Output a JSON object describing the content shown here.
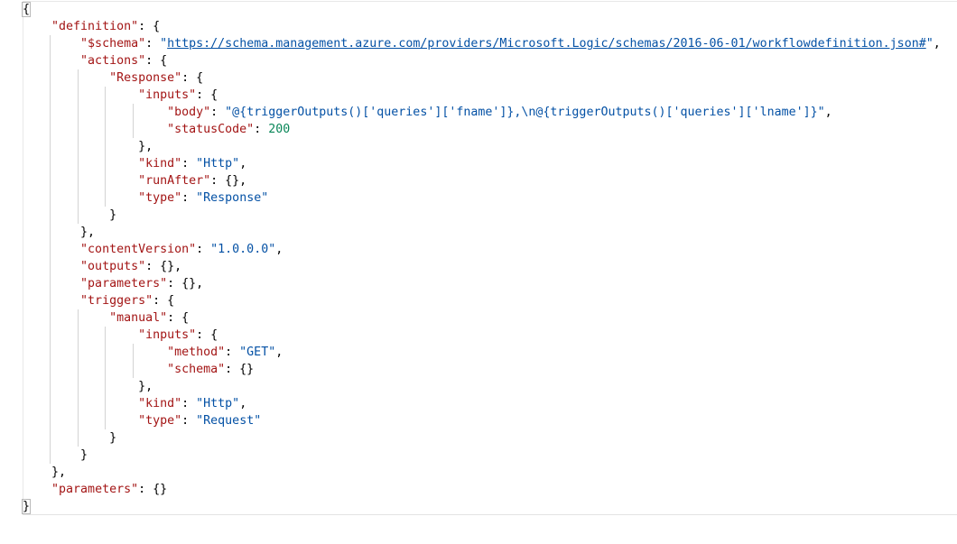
{
  "editor": {
    "lines": [
      [
        {
          "t": "p",
          "v": "{"
        }
      ],
      [
        {
          "t": "p",
          "v": "    "
        },
        {
          "t": "k",
          "v": "\"definition\""
        },
        {
          "t": "p",
          "v": ": {"
        }
      ],
      [
        {
          "t": "p",
          "v": "        "
        },
        {
          "t": "k",
          "v": "\"$schema\""
        },
        {
          "t": "p",
          "v": ": "
        },
        {
          "t": "s",
          "v": "\""
        },
        {
          "t": "u",
          "v": "https://schema.management.azure.com/providers/Microsoft.Logic/schemas/2016-06-01/workflowdefinition.json#"
        },
        {
          "t": "s",
          "v": "\""
        },
        {
          "t": "p",
          "v": ","
        }
      ],
      [
        {
          "t": "p",
          "v": "        "
        },
        {
          "t": "k",
          "v": "\"actions\""
        },
        {
          "t": "p",
          "v": ": {"
        }
      ],
      [
        {
          "t": "p",
          "v": "            "
        },
        {
          "t": "k",
          "v": "\"Response\""
        },
        {
          "t": "p",
          "v": ": {"
        }
      ],
      [
        {
          "t": "p",
          "v": "                "
        },
        {
          "t": "k",
          "v": "\"inputs\""
        },
        {
          "t": "p",
          "v": ": {"
        }
      ],
      [
        {
          "t": "p",
          "v": "                    "
        },
        {
          "t": "k",
          "v": "\"body\""
        },
        {
          "t": "p",
          "v": ": "
        },
        {
          "t": "s",
          "v": "\"@{triggerOutputs()['queries']['fname']},\\n@{triggerOutputs()['queries']['lname']}\""
        },
        {
          "t": "p",
          "v": ","
        }
      ],
      [
        {
          "t": "p",
          "v": "                    "
        },
        {
          "t": "k",
          "v": "\"statusCode\""
        },
        {
          "t": "p",
          "v": ": "
        },
        {
          "t": "n",
          "v": "200"
        }
      ],
      [
        {
          "t": "p",
          "v": "                },"
        }
      ],
      [
        {
          "t": "p",
          "v": "                "
        },
        {
          "t": "k",
          "v": "\"kind\""
        },
        {
          "t": "p",
          "v": ": "
        },
        {
          "t": "s",
          "v": "\"Http\""
        },
        {
          "t": "p",
          "v": ","
        }
      ],
      [
        {
          "t": "p",
          "v": "                "
        },
        {
          "t": "k",
          "v": "\"runAfter\""
        },
        {
          "t": "p",
          "v": ": {},"
        }
      ],
      [
        {
          "t": "p",
          "v": "                "
        },
        {
          "t": "k",
          "v": "\"type\""
        },
        {
          "t": "p",
          "v": ": "
        },
        {
          "t": "s",
          "v": "\"Response\""
        }
      ],
      [
        {
          "t": "p",
          "v": "            }"
        }
      ],
      [
        {
          "t": "p",
          "v": "        },"
        }
      ],
      [
        {
          "t": "p",
          "v": "        "
        },
        {
          "t": "k",
          "v": "\"contentVersion\""
        },
        {
          "t": "p",
          "v": ": "
        },
        {
          "t": "s",
          "v": "\"1.0.0.0\""
        },
        {
          "t": "p",
          "v": ","
        }
      ],
      [
        {
          "t": "p",
          "v": "        "
        },
        {
          "t": "k",
          "v": "\"outputs\""
        },
        {
          "t": "p",
          "v": ": {},"
        }
      ],
      [
        {
          "t": "p",
          "v": "        "
        },
        {
          "t": "k",
          "v": "\"parameters\""
        },
        {
          "t": "p",
          "v": ": {},"
        }
      ],
      [
        {
          "t": "p",
          "v": "        "
        },
        {
          "t": "k",
          "v": "\"triggers\""
        },
        {
          "t": "p",
          "v": ": {"
        }
      ],
      [
        {
          "t": "p",
          "v": "            "
        },
        {
          "t": "k",
          "v": "\"manual\""
        },
        {
          "t": "p",
          "v": ": {"
        }
      ],
      [
        {
          "t": "p",
          "v": "                "
        },
        {
          "t": "k",
          "v": "\"inputs\""
        },
        {
          "t": "p",
          "v": ": {"
        }
      ],
      [
        {
          "t": "p",
          "v": "                    "
        },
        {
          "t": "k",
          "v": "\"method\""
        },
        {
          "t": "p",
          "v": ": "
        },
        {
          "t": "s",
          "v": "\"GET\""
        },
        {
          "t": "p",
          "v": ","
        }
      ],
      [
        {
          "t": "p",
          "v": "                    "
        },
        {
          "t": "k",
          "v": "\"schema\""
        },
        {
          "t": "p",
          "v": ": {}"
        }
      ],
      [
        {
          "t": "p",
          "v": "                },"
        }
      ],
      [
        {
          "t": "p",
          "v": "                "
        },
        {
          "t": "k",
          "v": "\"kind\""
        },
        {
          "t": "p",
          "v": ": "
        },
        {
          "t": "s",
          "v": "\"Http\""
        },
        {
          "t": "p",
          "v": ","
        }
      ],
      [
        {
          "t": "p",
          "v": "                "
        },
        {
          "t": "k",
          "v": "\"type\""
        },
        {
          "t": "p",
          "v": ": "
        },
        {
          "t": "s",
          "v": "\"Request\""
        }
      ],
      [
        {
          "t": "p",
          "v": "            }"
        }
      ],
      [
        {
          "t": "p",
          "v": "        }"
        }
      ],
      [
        {
          "t": "p",
          "v": "    },"
        }
      ],
      [
        {
          "t": "p",
          "v": "    "
        },
        {
          "t": "k",
          "v": "\"parameters\""
        },
        {
          "t": "p",
          "v": ": {}"
        }
      ],
      [
        {
          "t": "p",
          "v": "}"
        }
      ]
    ]
  },
  "colors": {
    "key": "#a31515",
    "string": "#0451a5",
    "number": "#098658",
    "punctuation": "#000000"
  }
}
